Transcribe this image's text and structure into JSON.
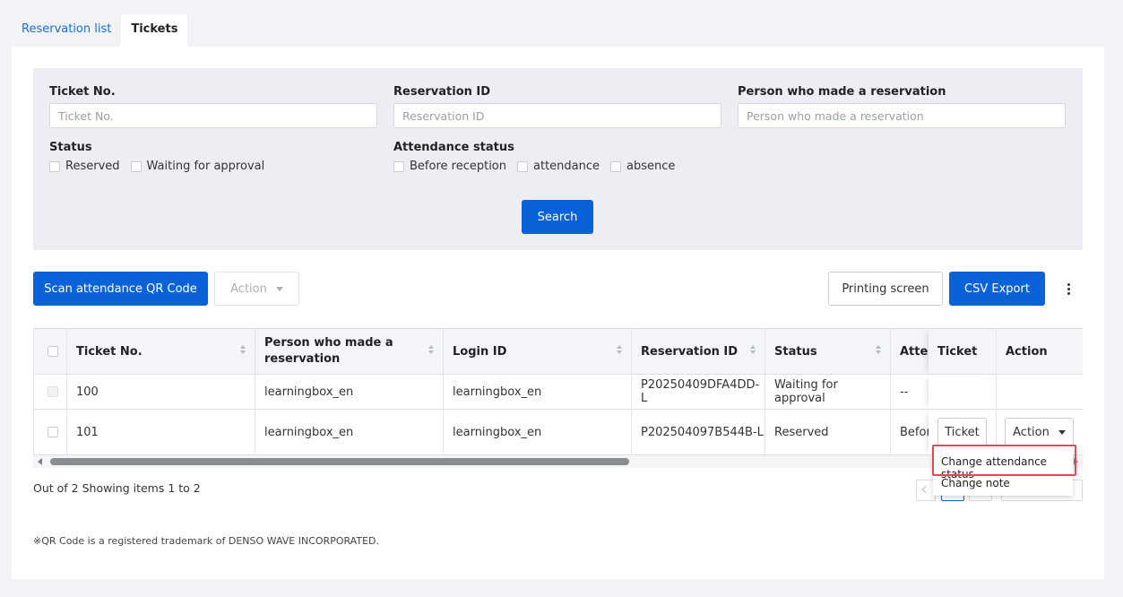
{
  "tabs": [
    {
      "label": "Reservation list",
      "active": false
    },
    {
      "label": "Tickets",
      "active": true
    }
  ],
  "filters": {
    "ticket_no_label": "Ticket No.",
    "ticket_no_placeholder": "Ticket No.",
    "reservation_id_label": "Reservation ID",
    "reservation_id_placeholder": "Reservation ID",
    "person_label": "Person who made a reservation",
    "person_placeholder": "Person who made a reservation",
    "status_label": "Status",
    "status_options": [
      "Reserved",
      "Waiting for approval"
    ],
    "attendance_label": "Attendance status",
    "attendance_options": [
      "Before reception",
      "attendance",
      "absence"
    ],
    "search_label": "Search"
  },
  "toolbar": {
    "scan_label": "Scan attendance QR Code",
    "action_label": "Action",
    "print_label": "Printing screen",
    "csv_label": "CSV Export"
  },
  "table": {
    "columns": [
      "Ticket No.",
      "Person who made a reservation",
      "Login ID",
      "Reservation ID",
      "Status",
      "Atten",
      "Ticket",
      "Action"
    ],
    "rows": [
      {
        "ticket_no": "100",
        "person": "learningbox_en",
        "login_id": "learningbox_en",
        "reservation_id": "P20250409DFA4DD-L",
        "status": "Waiting for approval",
        "attendance": "--"
      },
      {
        "ticket_no": "101",
        "person": "learningbox_en",
        "login_id": "learningbox_en",
        "reservation_id": "P202504097B544B-L",
        "status": "Reserved",
        "attendance": "Befor",
        "ticket_button": "Ticket",
        "action_button": "Action"
      }
    ]
  },
  "summary": "Out of 2 Showing items 1 to 2",
  "dropdown": {
    "items": [
      "Change attendance status",
      "Change note"
    ]
  },
  "footnote": "※QR Code is a registered trademark of DENSO WAVE INCORPORATED.",
  "colors": {
    "primary": "#0a62d8",
    "highlight": "#e34b52"
  }
}
